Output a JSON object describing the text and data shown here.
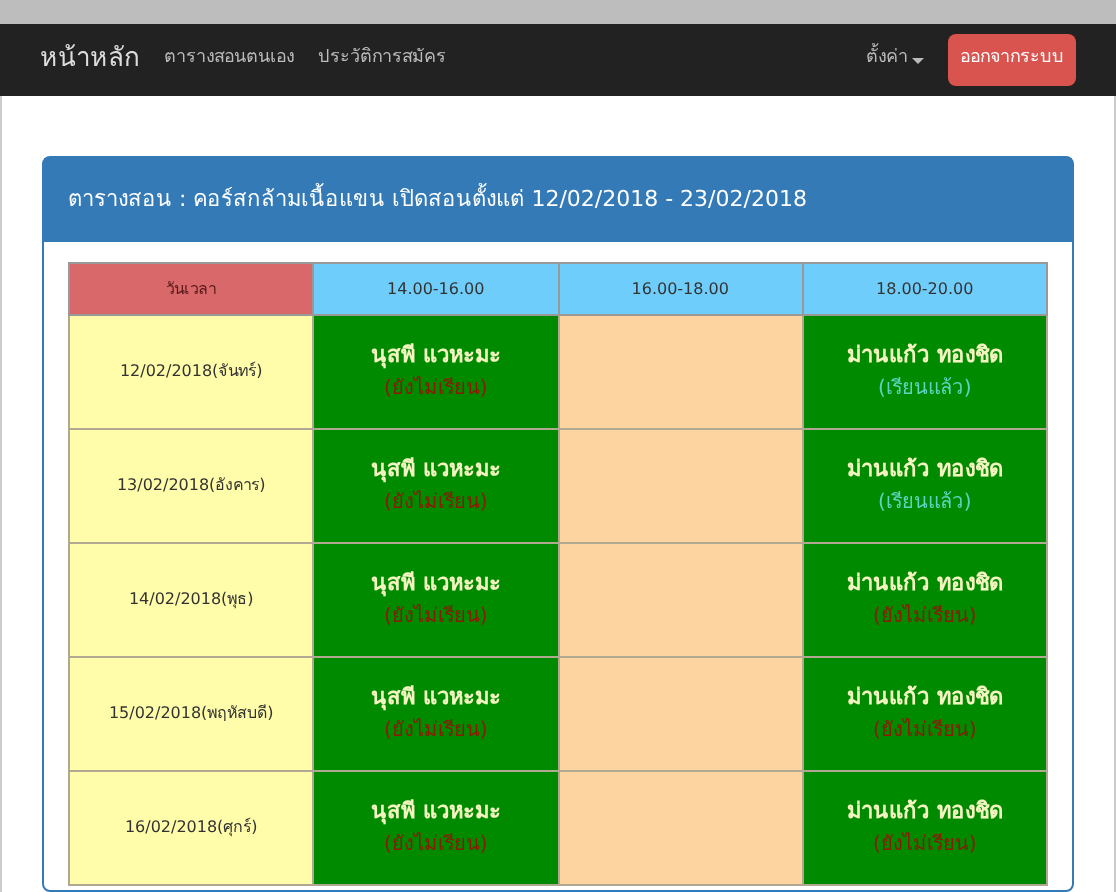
{
  "navbar": {
    "brand": "หน้าหลัก",
    "links": [
      "ตารางสอนตนเอง",
      "ประวัติการสมัคร"
    ],
    "settings": "ตั้งค่า",
    "logout": "ออกจากระบบ"
  },
  "panel": {
    "title": "ตารางสอน : คอร์สกล้ามเนื้อแขน เปิดสอนตั้งแต่ 12/02/2018 - 23/02/2018"
  },
  "table": {
    "columns": [
      "วันเวลา",
      "14.00-16.00",
      "16.00-18.00",
      "18.00-20.00"
    ],
    "rows": [
      {
        "date": "12/02/2018(จันทร์)",
        "slots": [
          {
            "kind": "booked",
            "name": "นุสพี แวหะมะ",
            "status": "(ยังไม่เรียน)",
            "done": false
          },
          {
            "kind": "empty"
          },
          {
            "kind": "booked",
            "name": "ม่านแก้ว ทองชิด",
            "status": "(เรียนแล้ว)",
            "done": true
          }
        ]
      },
      {
        "date": "13/02/2018(อังคาร)",
        "slots": [
          {
            "kind": "booked",
            "name": "นุสพี แวหะมะ",
            "status": "(ยังไม่เรียน)",
            "done": false
          },
          {
            "kind": "empty"
          },
          {
            "kind": "booked",
            "name": "ม่านแก้ว ทองชิด",
            "status": "(เรียนแล้ว)",
            "done": true
          }
        ]
      },
      {
        "date": "14/02/2018(พุธ)",
        "slots": [
          {
            "kind": "booked",
            "name": "นุสพี แวหะมะ",
            "status": "(ยังไม่เรียน)",
            "done": false
          },
          {
            "kind": "empty"
          },
          {
            "kind": "booked",
            "name": "ม่านแก้ว ทองชิด",
            "status": "(ยังไม่เรียน)",
            "done": false
          }
        ]
      },
      {
        "date": "15/02/2018(พฤหัสบดี)",
        "slots": [
          {
            "kind": "booked",
            "name": "นุสพี แวหะมะ",
            "status": "(ยังไม่เรียน)",
            "done": false
          },
          {
            "kind": "empty"
          },
          {
            "kind": "booked",
            "name": "ม่านแก้ว ทองชิด",
            "status": "(ยังไม่เรียน)",
            "done": false
          }
        ]
      },
      {
        "date": "16/02/2018(ศุกร์)",
        "slots": [
          {
            "kind": "booked",
            "name": "นุสพี แวหะมะ",
            "status": "(ยังไม่เรียน)",
            "done": false
          },
          {
            "kind": "empty"
          },
          {
            "kind": "booked",
            "name": "ม่านแก้ว ทองชิด",
            "status": "(ยังไม่เรียน)",
            "done": false
          }
        ]
      }
    ]
  }
}
